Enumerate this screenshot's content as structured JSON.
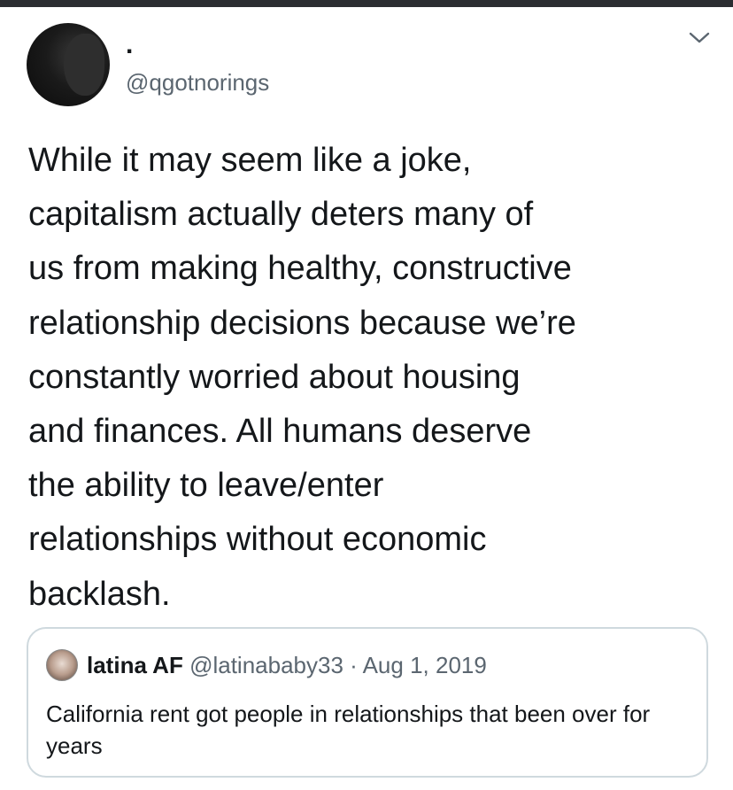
{
  "author": {
    "display_name": ".",
    "handle": "@qgotnorings"
  },
  "tweet": {
    "text": "While it may seem like a joke,\ncapitalism actually deters many of\nus from making healthy, constructive\nrelationship decisions because we’re\nconstantly worried about housing\nand finances. All humans deserve\nthe ability to leave/enter\nrelationships without economic\nbacklash."
  },
  "quoted_tweet": {
    "display_name": "latina AF",
    "handle": "@latinababy33",
    "separator": " · ",
    "date": "Aug 1, 2019",
    "text": "California rent got people in relationships that been over for years"
  },
  "icons": {
    "menu": "chevron-down-icon"
  },
  "colors": {
    "text": "#14171a",
    "secondary_text": "#5b6670",
    "border": "#cfd9de"
  }
}
